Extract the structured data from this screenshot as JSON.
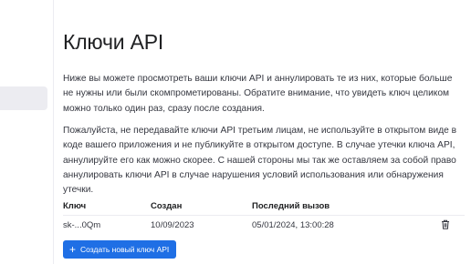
{
  "page": {
    "title": "Ключи API",
    "description_1": "Ниже вы можете просмотреть ваши ключи API и аннулировать те из них, которые больше не нужны или были скомпрометированы. Обратите внимание, что увидеть ключ целиком можно только один раз, сразу после создания.",
    "description_2": "Пожалуйста, не передавайте ключи API третьим лицам, не используйте в открытом виде в коде вашего приложения и не публикуйте в открытом доступе. В случае утечки ключа API, аннулируйте его как можно скорее. С нашей стороны мы так же оставляем за собой право аннулировать ключи API в случае нарушения условий использования или обнаружения утечки."
  },
  "table": {
    "columns": [
      "Ключ",
      "Создан",
      "Последний вызов"
    ],
    "rows": [
      {
        "key": "sk-...0Qm",
        "created": "10/09/2023",
        "last_used": "05/01/2024, 13:00:28"
      }
    ]
  },
  "actions": {
    "create_label": "Создать новый ключ API"
  },
  "icons": {
    "delete": "trash-icon",
    "create": "plus-icon"
  },
  "colors": {
    "primary_button": "#1f6fe5",
    "sidebar_active": "#ececf1"
  }
}
